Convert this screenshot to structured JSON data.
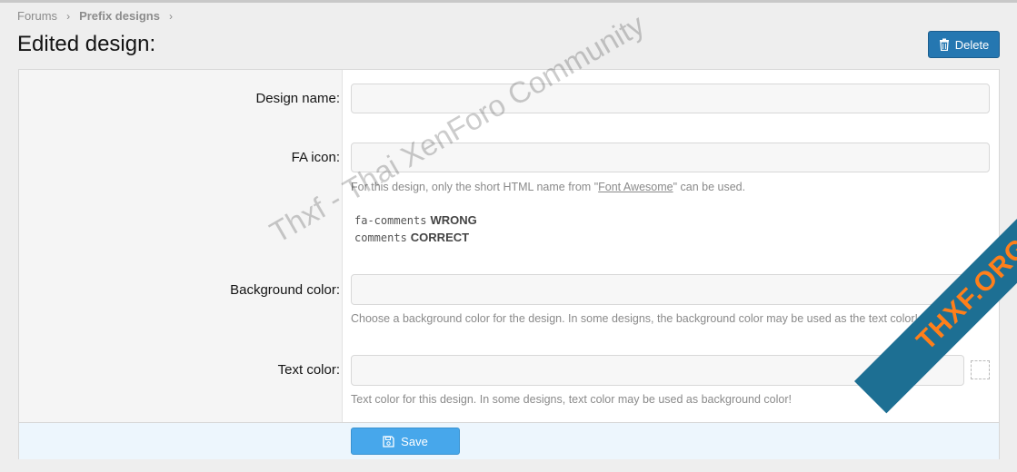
{
  "breadcrumb": {
    "items": [
      "Forums",
      "Prefix designs"
    ]
  },
  "page": {
    "title": "Edited design:"
  },
  "actions": {
    "delete_label": "Delete"
  },
  "form": {
    "design_name": {
      "label": "Design name:",
      "value": ""
    },
    "fa_icon": {
      "label": "FA icon:",
      "value": "",
      "hint_prefix": "For this design, only the short HTML name from \"",
      "hint_link": "Font Awesome",
      "hint_suffix": "\" can be used.",
      "examples": [
        {
          "code": "fa-comments",
          "verdict": "WRONG"
        },
        {
          "code": "comments",
          "verdict": "CORRECT"
        }
      ]
    },
    "background_color": {
      "label": "Background color:",
      "value": "",
      "hint": "Choose a background color for the design. In some designs, the background color may be used as the text color!"
    },
    "text_color": {
      "label": "Text color:",
      "value": "",
      "hint": "Text color for this design. In some designs, text color may be used as background color!"
    },
    "save_label": "Save"
  },
  "watermark": {
    "text": "Thxf - Thai XenForo Community",
    "badge": "THXF.ORG"
  },
  "colors": {
    "primary": "#2577b1",
    "save": "#47a7eb",
    "footer_bg": "#edf6fd"
  }
}
